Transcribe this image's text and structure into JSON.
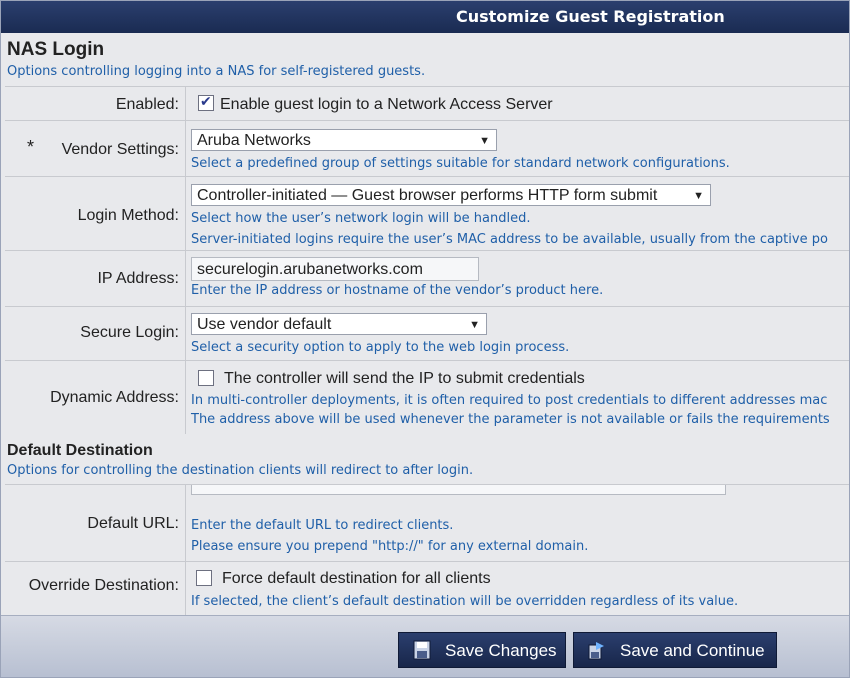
{
  "window": {
    "title": "Customize Guest Registration"
  },
  "nas_section": {
    "title": "NAS Login",
    "description": "Options controlling logging into a NAS for self-registered guests."
  },
  "enabled": {
    "label": "Enabled:",
    "checkbox_text": "Enable guest login to a Network Access Server",
    "checked": true
  },
  "vendor": {
    "required_marker": "*",
    "label": "Vendor Settings:",
    "selected": "Aruba Networks",
    "hint": "Select a predefined group of settings suitable for standard network configurations."
  },
  "login_method": {
    "label": "Login Method:",
    "selected": "Controller-initiated — Guest browser performs HTTP form submit",
    "hint1": "Select how the user’s network login will be handled.",
    "hint2": "Server-initiated logins require the user’s MAC address to be available, usually from the captive po"
  },
  "ip_address": {
    "label": "IP Address:",
    "value": "securelogin.arubanetworks.com",
    "hint": "Enter the IP address or hostname of the vendor’s product here."
  },
  "secure_login": {
    "label": "Secure Login:",
    "selected": "Use vendor default",
    "hint": "Select a security option to apply to the web login process."
  },
  "dynamic_address": {
    "label": "Dynamic Address:",
    "checkbox_text": "The controller will send the IP to submit credentials",
    "checked": false,
    "hint1": "In multi-controller deployments, it is often required to post credentials to different addresses mac",
    "hint2": "The address above will be used whenever the parameter is not available or fails the requirements"
  },
  "dest_section": {
    "title": "Default Destination",
    "description": "Options for controlling the destination clients will redirect to after login."
  },
  "default_url": {
    "label": "Default URL:",
    "value": "",
    "hint1": "Enter the default URL to redirect clients.",
    "hint2": "Please ensure you prepend \"http://\" for any external domain."
  },
  "override": {
    "label": "Override Destination:",
    "checkbox_text": "Force default destination for all clients",
    "checked": false,
    "hint": "If selected, the client’s default destination will be overridden regardless of its value."
  },
  "buttons": {
    "save": "Save Changes",
    "save_continue": "Save and Continue"
  },
  "colors": {
    "accent": "#1f5fa8",
    "titlebar": "#1a2b52"
  }
}
